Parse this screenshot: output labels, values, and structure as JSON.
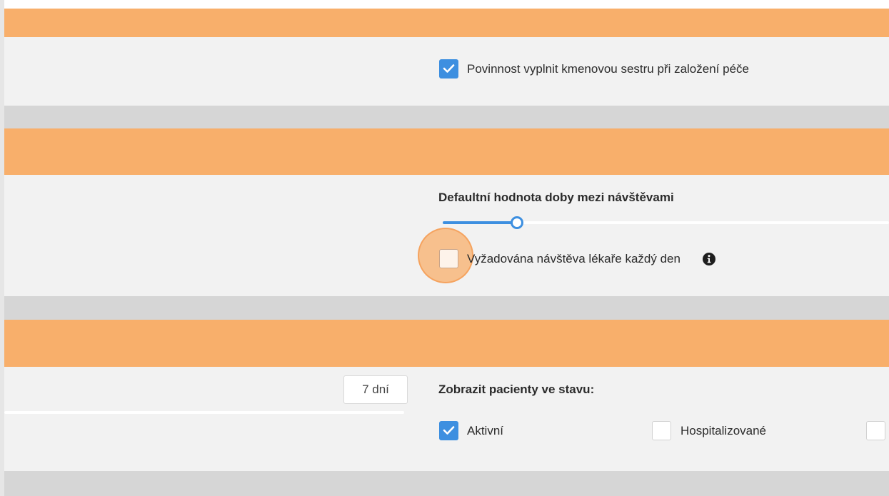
{
  "settings": {
    "colors": {
      "accent": "#f8af6b",
      "checkbox": "#3d8fe0",
      "panel": "#f2f2f2",
      "separator": "#d6d6d6"
    },
    "section1": {
      "mandatory_nurse_checkbox": {
        "label": "Povinnost vyplnit kmenovou sestru při založení péče",
        "checked": true
      }
    },
    "section2": {
      "visit_interval": {
        "label": "Defaultní hodnota doby mezi návštěvami",
        "slider_level": 0.17
      },
      "daily_doctor_visit": {
        "label": "Vyžadována návštěva lékaře každý den",
        "checked": false,
        "icon": "info-icon"
      }
    },
    "section3": {
      "days_value": "7 dní",
      "show_patients": {
        "label": "Zobrazit pacienty ve stavu:",
        "options": [
          {
            "label": "Aktivní",
            "checked": true
          },
          {
            "label": "Hospitalizované",
            "checked": false
          }
        ]
      }
    }
  }
}
